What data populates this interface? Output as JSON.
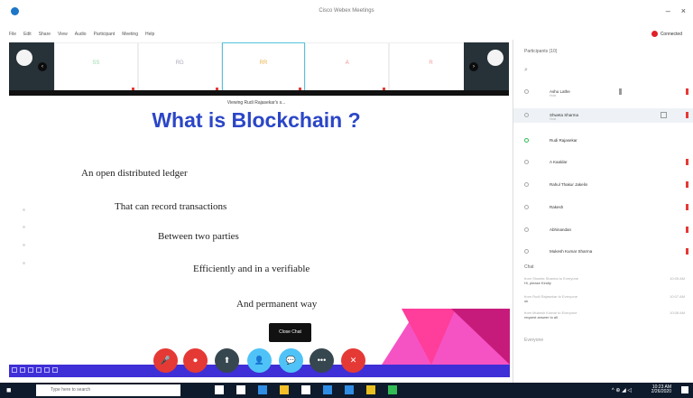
{
  "window": {
    "title": "Cisco Webex Meetings",
    "minimize": "–",
    "close": "×",
    "status": "Connected"
  },
  "menu": [
    "File",
    "Edit",
    "Share",
    "View",
    "Audio",
    "Participant",
    "Meeting",
    "Help"
  ],
  "video_strip": [
    {
      "initials": "SS",
      "name": "Shweta Sharma"
    },
    {
      "initials": "RG",
      "name": "Ravi Gaur"
    },
    {
      "initials": "RR",
      "name": "Rudi Rajasekar",
      "active": true
    },
    {
      "initials": "A",
      "name": "A Kaaldar"
    },
    {
      "initials": "R",
      "name": "R Jothikhan"
    }
  ],
  "slide": {
    "sharing_note": "Viewing Rudi Rajasekar's s...",
    "title": "What is Blockchain ?",
    "lines": [
      "An open distributed ledger",
      "That can record transactions",
      "Between two parties",
      "Efficiently and in a verifiable",
      "And permanent way"
    ]
  },
  "close_chat_label": "Close Chat",
  "controls": [
    {
      "name": "mute-button",
      "glyph": "🎤",
      "color": "#e53935"
    },
    {
      "name": "video-button",
      "glyph": "⏺",
      "color": "#e53935"
    },
    {
      "name": "share-button",
      "glyph": "⬆",
      "color": "#37474f"
    },
    {
      "name": "participants-button",
      "glyph": "👤",
      "color": "#4fc3f7"
    },
    {
      "name": "chat-button",
      "glyph": "💬",
      "color": "#4fc3f7"
    },
    {
      "name": "more-button",
      "glyph": "•••",
      "color": "#37474f"
    },
    {
      "name": "leave-button",
      "glyph": "✕",
      "color": "#e53935"
    }
  ],
  "sidebar": {
    "header": "Participants (10)",
    "search_glyph": "⌕",
    "participants": [
      {
        "name": "Ashu Lathe",
        "sub": "Host"
      },
      {
        "name": "Shweta Sharma",
        "sub": "Host",
        "selected": true
      },
      {
        "name": "Rudi Rajasekar",
        "sub": ""
      },
      {
        "name": "A Kaaldar",
        "sub": ""
      },
      {
        "name": "Rahul Thakur Jakelin",
        "sub": ""
      },
      {
        "name": "Rakesh",
        "sub": ""
      },
      {
        "name": "Abhinandan",
        "sub": ""
      },
      {
        "name": "Mukesh Kumar Sharma",
        "sub": ""
      }
    ],
    "chat_header": "Chat",
    "chat_messages": [
      {
        "from": "from Shweta Sharma to Everyone",
        "text": "Hi, please Kindly",
        "time": "10:05 AM"
      },
      {
        "from": "from Rudi Rajasekar to Everyone",
        "text": "ok",
        "time": "10:07 AM"
      },
      {
        "from": "from Mukesh Kumar to Everyone",
        "text": "request answer to all",
        "time": "10:08 AM"
      }
    ],
    "chat_placeholder": "Everyone"
  },
  "taskbar": {
    "search_placeholder": "Type here to search",
    "time": "10:23 AM",
    "date": "2/26/2020",
    "apps": [
      "#ffffff",
      "#ffffff",
      "#2f8de4",
      "#f3c02a",
      "#ffffff",
      "#2f8de4",
      "#2f8de4",
      "#e8c020",
      "#3b5"
    ]
  }
}
